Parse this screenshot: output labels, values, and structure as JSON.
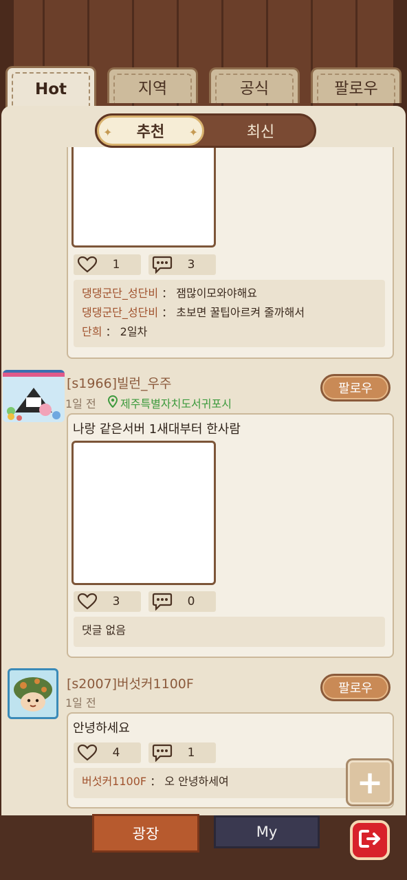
{
  "tabs": [
    {
      "label": "Hot",
      "active": true
    },
    {
      "label": "지역",
      "active": false
    },
    {
      "label": "공식",
      "active": false
    },
    {
      "label": "팔로우",
      "active": false
    }
  ],
  "segment": {
    "recommended": "추천",
    "latest": "최신"
  },
  "post1": {
    "likes": "1",
    "comments_count": "3",
    "comments": [
      {
        "name": "댕댕군단_성단비",
        "sep": "：",
        "text": "잼많이모와야해요"
      },
      {
        "name": "댕댕군단_성단비",
        "sep": "：",
        "text": "초보면 꿀팁아르켜 줄까해서"
      },
      {
        "name": "단희",
        "sep": "：",
        "text": "2일차"
      }
    ]
  },
  "post2": {
    "username": "[s1966]빌런_우주",
    "time": "1일 전",
    "location": "제주특별자치도서귀포시",
    "follow": "팔로우",
    "text": "나랑 같은서버 1새대부터 한사람",
    "likes": "3",
    "comments_count": "0",
    "no_comments": "댓글 없음"
  },
  "post3": {
    "username": "[s2007]버섯커1100F",
    "time": "1일 전",
    "follow": "팔로우",
    "text": "안녕하세요",
    "likes": "4",
    "comments_count": "1",
    "comments": [
      {
        "name": "버섯커1100F",
        "sep": "：",
        "text": "오 안녕하세여"
      }
    ]
  },
  "bottom_nav": {
    "square": "광장",
    "my": "My"
  },
  "colors": {
    "accent": "#c98a56",
    "follow_border": "#8a5a3a",
    "location": "#3d9a3d",
    "exit": "#d8222b"
  }
}
